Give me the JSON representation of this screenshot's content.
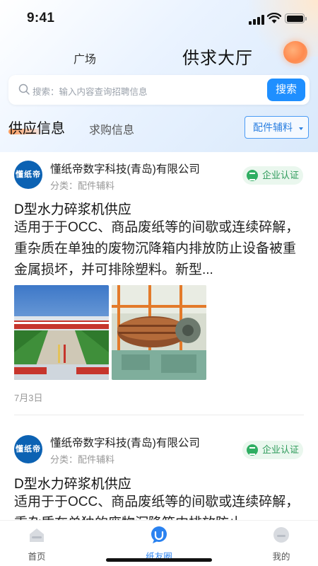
{
  "status_bar": {
    "time": "9:41"
  },
  "header": {
    "nav_plaza": "广场",
    "title": "供求大厅"
  },
  "search": {
    "placeholder": "搜索：输入内容查询招聘信息",
    "button_label": "搜索"
  },
  "tabs": {
    "supply": "供应信息",
    "demand": "求购信息",
    "filter_label": "配件辅料"
  },
  "posts": [
    {
      "logo_text": "懂纸帝",
      "company": "懂纸帝数字科技(青岛)有限公司",
      "category": "分类：配件辅料",
      "badge": "企业认证",
      "title": "D型水力碎浆机供应",
      "body": "适用于于OCC、商品废纸等的间歇或连续碎解，重杂质在单独的废物沉降箱内排放防止设备被重金属损坏，并可排除塑料。新型...",
      "date": "7月3日"
    },
    {
      "logo_text": "懂纸帝",
      "company": "懂纸帝数字科技(青岛)有限公司",
      "category": "分类：配件辅料",
      "badge": "企业认证",
      "title": "D型水力碎浆机供应",
      "body": "适用于于OCC、商品废纸等的间歇或连续碎解，重杂质在单独的废物沉降箱内排放防止"
    }
  ],
  "tabbar": {
    "home": "首页",
    "paper_circle": "纸友圈",
    "mine": "我的"
  },
  "colors": {
    "accent": "#1f8fff",
    "verified_green": "#2c9a59",
    "tab_underline": "#ff9a5a"
  }
}
